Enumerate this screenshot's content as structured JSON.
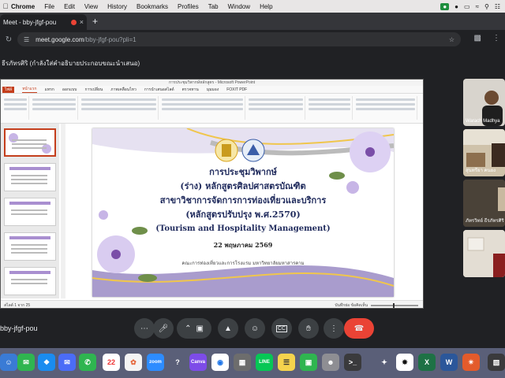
{
  "menubar": {
    "app": "Chrome",
    "items": [
      "File",
      "Edit",
      "View",
      "History",
      "Bookmarks",
      "Profiles",
      "Tab",
      "Window",
      "Help"
    ]
  },
  "browser": {
    "tab_title": "Meet - bby-jfgf-pou",
    "url_host": "meet.google.com",
    "url_path": "/bby-jfgf-pou?pli=1"
  },
  "meet": {
    "presenting_caption": "ธีรภัทรศิริ (กำลังใส่คำอธิบายประกอบขณะนำเสนอ)",
    "meeting_code": "bby-jfgf-pou",
    "participants": [
      {
        "name": "Warach Madhya"
      },
      {
        "name": "สุนทรียา คนยง"
      },
      {
        "name": "ภัทรวิทย์ ธีรภัทรศิริ"
      },
      {
        "name": ""
      }
    ]
  },
  "powerpoint": {
    "window_title": "การประชุมวิพากษ์หลักสูตร - Microsoft PowerPoint",
    "tabs": [
      "ไฟล์",
      "หน้าแรก",
      "แทรก",
      "ออกแบบ",
      "การเปลี่ยน",
      "ภาพเคลื่อนไหว",
      "การนำเสนอสไลด์",
      "ตรวจทาน",
      "มุมมอง",
      "FOXIT PDF"
    ],
    "active_tab": "หน้าแรก",
    "status_left": "สไลด์ 1 จาก 25",
    "status_right": "บันทึกย่อ  ข้อคิดเห็น"
  },
  "slide": {
    "title_line1": "การประชุมวิพากษ์",
    "title_line2": "(ร่าง) หลักสูตรศิลปศาสตรบัณฑิต",
    "title_line3": "สาขาวิชาการจัดการการท่องเที่ยวและบริการ",
    "title_line4": "(หลักสูตรปรับปรุง พ.ศ.2570)",
    "title_english": "(Tourism and Hospitality Management)",
    "date": "22 พฤษภาคม 2569",
    "faculty": "คณะการท่องเที่ยวและการโรงแรม มหาวิทยาลัยมหาสารคาม"
  },
  "dock": {
    "calendar_day": "22"
  },
  "colors": {
    "end_call": "#ea4335",
    "ppt_accent": "#c43e1c",
    "slide_title": "#1f2a5c",
    "flower": "#c7b5e6"
  }
}
